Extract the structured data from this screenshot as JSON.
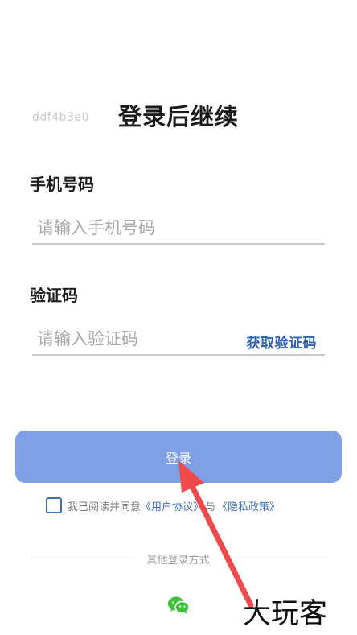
{
  "header": {
    "code_tag": "ddf4b3e0",
    "title": "登录后继续"
  },
  "phone": {
    "label": "手机号码",
    "placeholder": "请输入手机号码",
    "value": ""
  },
  "verify": {
    "label": "验证码",
    "placeholder": "请输入验证码",
    "value": "",
    "get_code_label": "获取验证码"
  },
  "login_button": {
    "label": "登录"
  },
  "agreement": {
    "prefix": "我已阅读并同意",
    "user_agreement": "《用户协议》",
    "connector": "与",
    "privacy_policy": "《隐私政策》",
    "checked": false
  },
  "other_login": {
    "label": "其他登录方式",
    "icons": [
      "wechat-icon"
    ]
  },
  "annotation": {
    "arrow_color": "#f04a4a",
    "watermark": "大玩客"
  },
  "colors": {
    "accent": "#2f62b3",
    "button": "#7f9fe6",
    "wechat": "#3ec23a"
  }
}
